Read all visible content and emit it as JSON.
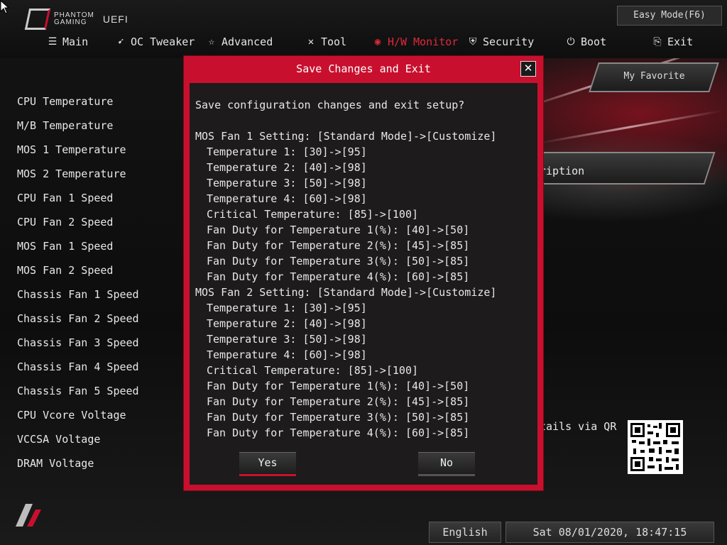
{
  "app": {
    "brand_line1": "PHANTOM",
    "brand_line2": "GAMING",
    "uefi_label": "UEFI"
  },
  "header": {
    "easy_mode_label": "Easy Mode(F6)"
  },
  "nav": {
    "items": [
      {
        "label": "Main",
        "icon": "list-icon"
      },
      {
        "label": "OC Tweaker",
        "icon": "rocket-icon"
      },
      {
        "label": "Advanced",
        "icon": "star-icon"
      },
      {
        "label": "Tool",
        "icon": "tools-icon"
      },
      {
        "label": "H/W Monitor",
        "icon": "monitor-icon",
        "active": true
      },
      {
        "label": "Security",
        "icon": "shield-icon"
      },
      {
        "label": "Boot",
        "icon": "power-icon"
      },
      {
        "label": "Exit",
        "icon": "exit-icon"
      }
    ]
  },
  "monitor_list": [
    "CPU Temperature",
    "M/B Temperature",
    "MOS 1 Temperature",
    "MOS 2 Temperature",
    "CPU Fan 1 Speed",
    "CPU Fan 2 Speed",
    "MOS Fan 1 Speed",
    "MOS Fan 2 Speed",
    "Chassis Fan 1 Speed",
    "Chassis Fan 2 Speed",
    "Chassis Fan 3 Speed",
    "Chassis Fan 4 Speed",
    "Chassis Fan 5 Speed",
    "CPU Vcore Voltage",
    "VCCSA Voltage",
    "DRAM Voltage"
  ],
  "right_panel": {
    "favorite_label": "My Favorite",
    "description_label": "ription",
    "qr_label": "tails via QR"
  },
  "dialog": {
    "title": "Save Changes and Exit",
    "close_glyph": "✕",
    "question": "Save configuration changes and exit setup?",
    "lines": [
      {
        "text": "MOS Fan 1 Setting: [Standard Mode]->[Customize]",
        "indent": false
      },
      {
        "text": "Temperature 1: [30]->[95]",
        "indent": true
      },
      {
        "text": "Temperature 2: [40]->[98]",
        "indent": true
      },
      {
        "text": "Temperature 3: [50]->[98]",
        "indent": true
      },
      {
        "text": "Temperature 4: [60]->[98]",
        "indent": true
      },
      {
        "text": "Critical Temperature: [85]->[100]",
        "indent": true
      },
      {
        "text": "Fan Duty for Temperature 1(%): [40]->[50]",
        "indent": true
      },
      {
        "text": "Fan Duty for Temperature 2(%): [45]->[85]",
        "indent": true
      },
      {
        "text": "Fan Duty for Temperature 3(%): [50]->[85]",
        "indent": true
      },
      {
        "text": "Fan Duty for Temperature 4(%): [60]->[85]",
        "indent": true
      },
      {
        "text": "MOS Fan 2 Setting: [Standard Mode]->[Customize]",
        "indent": false
      },
      {
        "text": "Temperature 1: [30]->[95]",
        "indent": true
      },
      {
        "text": "Temperature 2: [40]->[98]",
        "indent": true
      },
      {
        "text": "Temperature 3: [50]->[98]",
        "indent": true
      },
      {
        "text": "Temperature 4: [60]->[98]",
        "indent": true
      },
      {
        "text": "Critical Temperature: [85]->[100]",
        "indent": true
      },
      {
        "text": "Fan Duty for Temperature 1(%): [40]->[50]",
        "indent": true
      },
      {
        "text": "Fan Duty for Temperature 2(%): [45]->[85]",
        "indent": true
      },
      {
        "text": "Fan Duty for Temperature 3(%): [50]->[85]",
        "indent": true
      },
      {
        "text": "Fan Duty for Temperature 4(%): [60]->[85]",
        "indent": true
      }
    ],
    "yes_label": "Yes",
    "no_label": "No"
  },
  "footer": {
    "language": "English",
    "datetime": "Sat 08/01/2020, 18:47:15"
  },
  "colors": {
    "accent": "#c8102e",
    "active_nav": "#e0283c",
    "dialog_body": "#1d1b1b"
  }
}
